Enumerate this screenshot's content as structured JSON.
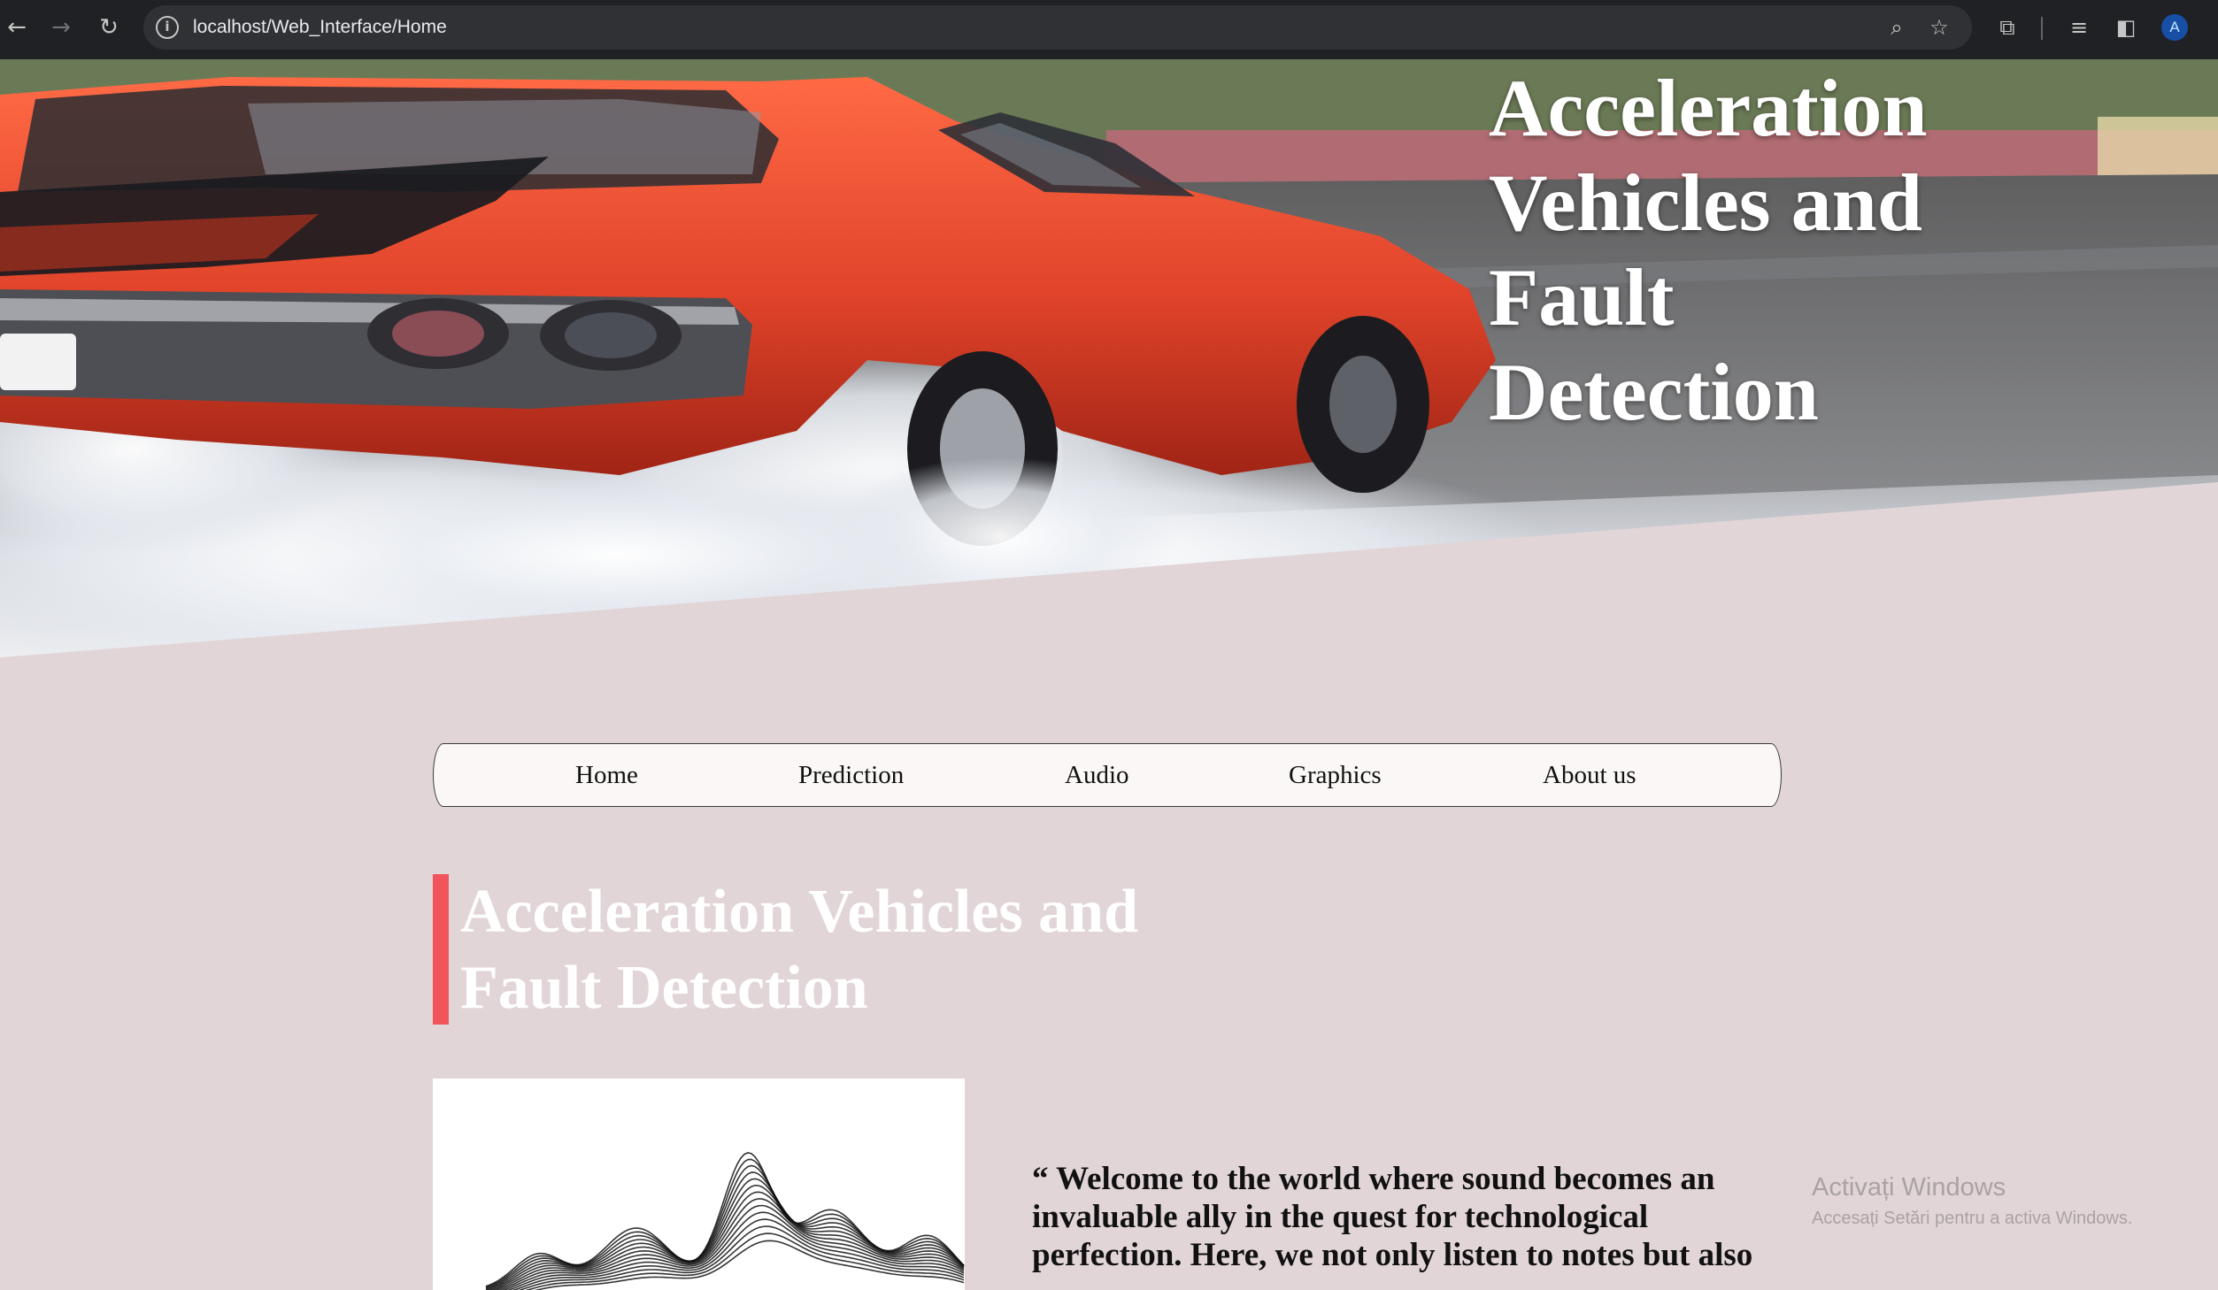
{
  "browser": {
    "url": "localhost/Web_Interface/Home",
    "info_glyph": "i",
    "back_glyph": "←",
    "forward_glyph": "→",
    "reload_glyph": "↻",
    "zoom_glyph": "⌕",
    "star_glyph": "☆",
    "extensions_glyph": "⧉",
    "media_glyph": "≡",
    "sidepanel_glyph": "◧",
    "avatar_initial": "A",
    "icons": [
      "back-icon",
      "forward-icon",
      "reload-icon",
      "site-info-icon",
      "zoom-icon",
      "bookmark-star-icon",
      "extensions-icon",
      "media-control-icon",
      "side-panel-icon"
    ]
  },
  "hero": {
    "title": "Acceleration Vehicles and Fault Detection",
    "image": "red muscle car doing a burnout on a race track",
    "colors": {
      "car": "#e0432a",
      "smoke": "#eef0f3"
    }
  },
  "nav": {
    "items": [
      {
        "label": "Home"
      },
      {
        "label": "Prediction"
      },
      {
        "label": "Audio"
      },
      {
        "label": "Graphics"
      },
      {
        "label": "About us"
      }
    ]
  },
  "section": {
    "title": "Acceleration Vehicles and Fault Detection",
    "accent_color": "#f2545b"
  },
  "intro": {
    "quote": "“ Welcome to the world where sound becomes an invaluable ally in the quest for technological perfection. Here, we not only listen to notes but also"
  },
  "watermark": {
    "title": "Activați Windows",
    "subtitle": "Accesați Setări pentru a activa Windows."
  },
  "colors": {
    "page_background": "#e2d5d7",
    "menu_background": "#fbf7f7",
    "heading_text": "#ffffff"
  }
}
